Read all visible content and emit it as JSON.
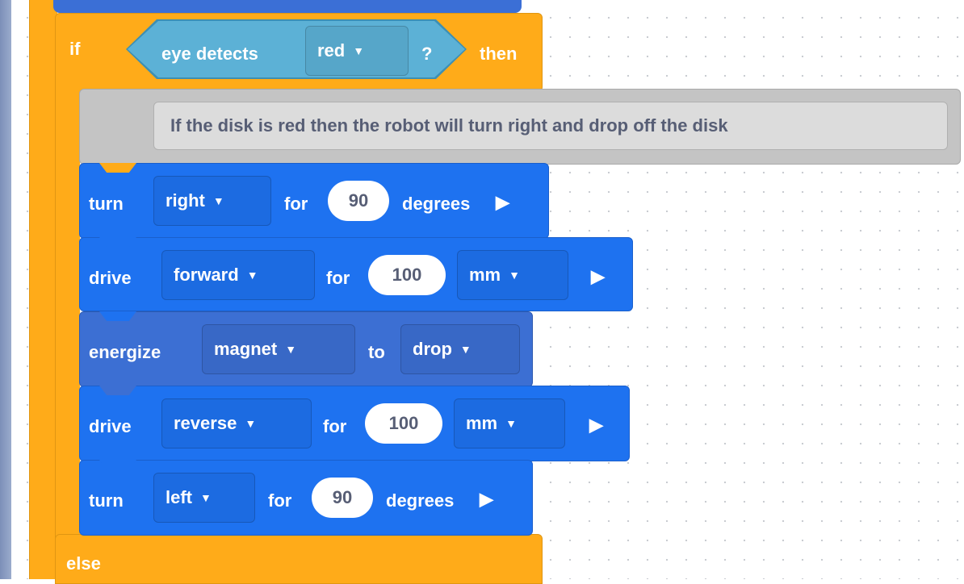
{
  "if_block": {
    "if_label": "if",
    "then_label": "then",
    "else_label": "else",
    "condition": {
      "text": "eye detects",
      "color_value": "red",
      "question": "?"
    }
  },
  "comment": {
    "text": "If the disk is red then the robot will turn right and drop off the disk"
  },
  "blocks": {
    "turn1": {
      "verb": "turn",
      "direction": "right",
      "for": "for",
      "value": "90",
      "unit": "degrees"
    },
    "drive1": {
      "verb": "drive",
      "direction": "forward",
      "for": "for",
      "value": "100",
      "unit": "mm"
    },
    "energize": {
      "verb": "energize",
      "target": "magnet",
      "to": "to",
      "action": "drop"
    },
    "drive2": {
      "verb": "drive",
      "direction": "reverse",
      "for": "for",
      "value": "100",
      "unit": "mm"
    },
    "turn2": {
      "verb": "turn",
      "direction": "left",
      "for": "for",
      "value": "90",
      "unit": "degrees"
    }
  },
  "colors": {
    "control": "#ffab19",
    "sensing": "#5cb1d6",
    "drivetrain": "#1e72f0",
    "magnet": "#3c6fd3",
    "comment": "#c4c4c4"
  }
}
